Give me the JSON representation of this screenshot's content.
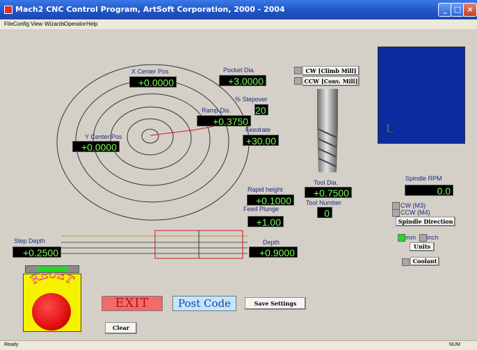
{
  "window": {
    "title": "Mach2 CNC Control Program, ArtSoft Corporation, 2000 - 2004"
  },
  "menu": [
    "File",
    "Config",
    "View",
    "Wizards",
    "Operator",
    "Help"
  ],
  "dro": {
    "x_center_label": "X Center Pos",
    "x_center_value": "+0.0000",
    "y_center_label": "Y Center Pos",
    "y_center_value": "+0.0000",
    "pocket_dia_label": "Pocket Dia.",
    "pocket_dia_value": "+3.0000",
    "stepover_label": "% Stepover",
    "stepover_value": "20",
    "ramp_dis_label": "Ramp Dis.",
    "ramp_dis_value": "+0.3750",
    "feedrate_label": "Feedrate",
    "feedrate_value": "+30.00",
    "rapid_height_label": "Rapid height",
    "rapid_height_value": "+0.1000",
    "feed_plunge_label": "Feed Plunge",
    "feed_plunge_value": "+1.00",
    "tool_dia_label": "Tool Dia.",
    "tool_dia_value": "+0.7500",
    "tool_number_label": "Tool Number",
    "tool_number_value": "0",
    "step_depth_label": "Step Depth",
    "step_depth_value": "+0.2500",
    "depth_label": "Depth",
    "depth_value": "+0.9000",
    "spindle_rpm_label": "Spindle RPM",
    "spindle_rpm_value": "0.0"
  },
  "buttons": {
    "cw_climb": "CW [Climb Mill]",
    "ccw_conv": "CCW [Conv. Mill]",
    "spindle_direction": "Spindle Direction",
    "units": "Units",
    "coolant": "Coolant",
    "exit": "EXIT",
    "post_code": "Post Code",
    "save_settings": "Save Settings",
    "clear": "Clear",
    "reset": "RESET"
  },
  "options": {
    "cw_m3": "CW (M3)",
    "ccw_m4": "CCW (M4)",
    "mm": "mm",
    "inch": "inch"
  },
  "colors": {
    "dro_text": "#7cff55",
    "dro_bg": "#000000",
    "preview_bg": "#0b2b9e",
    "exit_bg": "#f06b6b",
    "post_code_bg": "#bfe8ff",
    "reset_bg": "#f7f200",
    "reset_knob": "#e01010",
    "led_green": "#22dd22",
    "label_text": "#1a2a7a"
  },
  "status": {
    "left": "Ready",
    "right": "NUM"
  }
}
